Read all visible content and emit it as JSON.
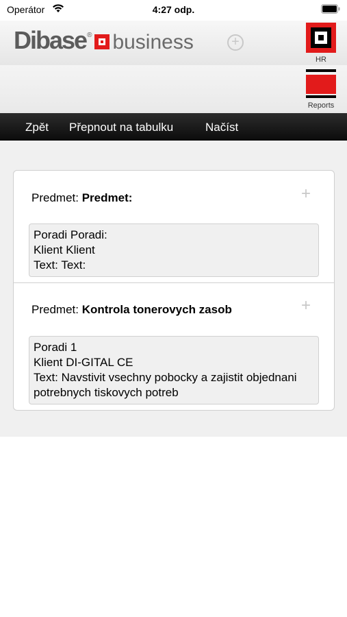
{
  "status_bar": {
    "carrier": "Operátor",
    "time": "4:27 odp."
  },
  "header": {
    "logo_di": "Dibase",
    "logo_business": "business",
    "hr_label": "HR",
    "reports_label": "Reports"
  },
  "nav": {
    "back": "Zpět",
    "switch_table": "Přepnout na tabulku",
    "load": "Načíst"
  },
  "records": [
    {
      "subject_label": "Predmet:",
      "subject_value": "Predmet:",
      "line1": "Poradi Poradi:",
      "line2": "Klient Klient",
      "line3": "Text: Text:"
    },
    {
      "subject_label": "Predmet:",
      "subject_value": "Kontrola tonerovych zasob",
      "line1": "Poradi 1",
      "line2": "Klient DI-GITAL CE",
      "line3": "Text: Navstivit vsechny pobocky a zajistit objednani potrebnych tiskovych potreb"
    }
  ],
  "colors": {
    "brand_red": "#e21b1b",
    "toolbar": "#1a1a1a",
    "logo_gray": "#5b5b5b"
  }
}
